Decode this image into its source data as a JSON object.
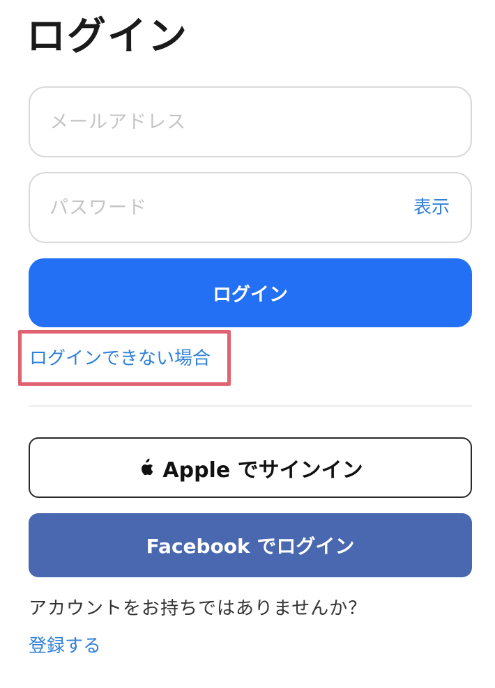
{
  "page": {
    "title": "ログイン"
  },
  "form": {
    "email_placeholder": "メールアドレス",
    "password_placeholder": "パスワード",
    "show_password_label": "表示",
    "login_button_label": "ログイン",
    "forgot_link_label": "ログインできない場合"
  },
  "social": {
    "apple_button_label": "Apple でサインイン",
    "facebook_button_label": "Facebook でログイン"
  },
  "footer": {
    "no_account_text": "アカウントをお持ちではありませんか？",
    "register_link_label": "登録する"
  },
  "colors": {
    "primary_blue": "#2370f5",
    "link_blue": "#2f80d8",
    "facebook_blue": "#4a68b0",
    "highlight_red": "#e0616f"
  },
  "icons": {
    "apple": "apple-logo-icon"
  }
}
